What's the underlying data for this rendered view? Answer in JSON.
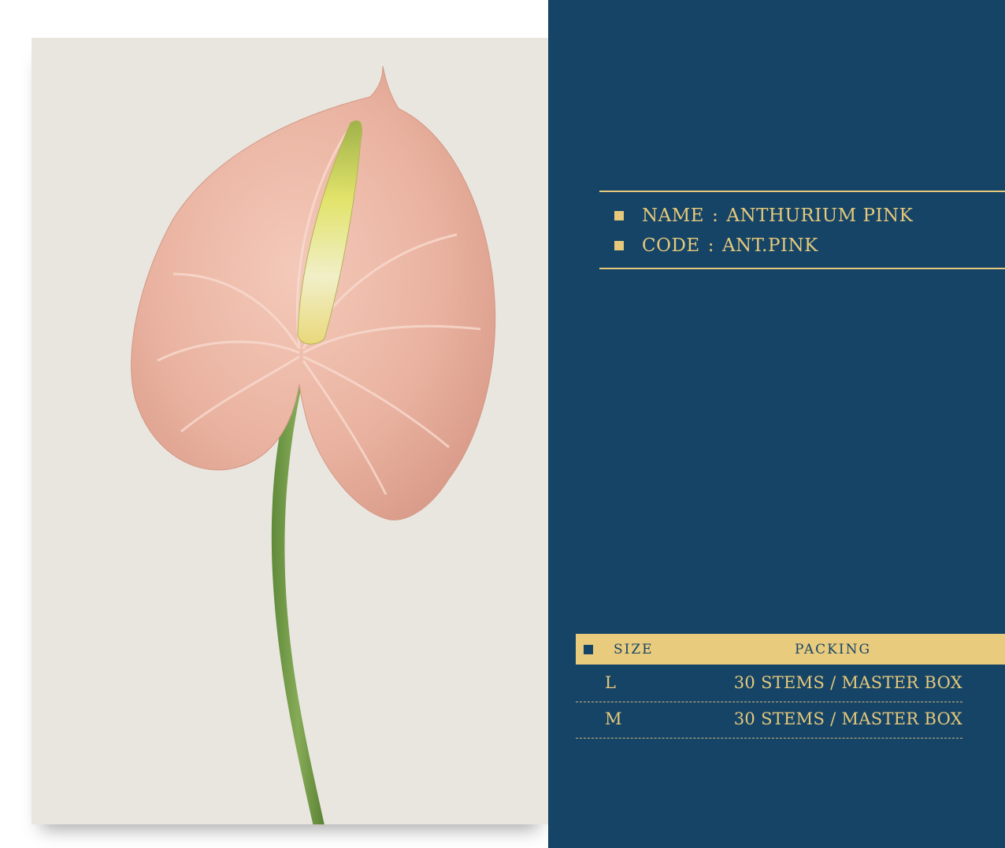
{
  "product": {
    "name_label": "NAME",
    "name_value": "ANTHURIUM PINK",
    "code_label": "CODE",
    "code_value": "ANT.PINK",
    "separator": ":"
  },
  "table": {
    "headers": {
      "size": "SIZE",
      "packing": "PACKING"
    },
    "rows": [
      {
        "size": "L",
        "packing": "30 STEMS / MASTER BOX"
      },
      {
        "size": "M",
        "packing": "30 STEMS / MASTER BOX"
      }
    ]
  },
  "colors": {
    "panel": "#164467",
    "accent": "#e6c97a",
    "photo_bg": "#e9e6df"
  },
  "image": {
    "subject": "anthurium-flower"
  }
}
